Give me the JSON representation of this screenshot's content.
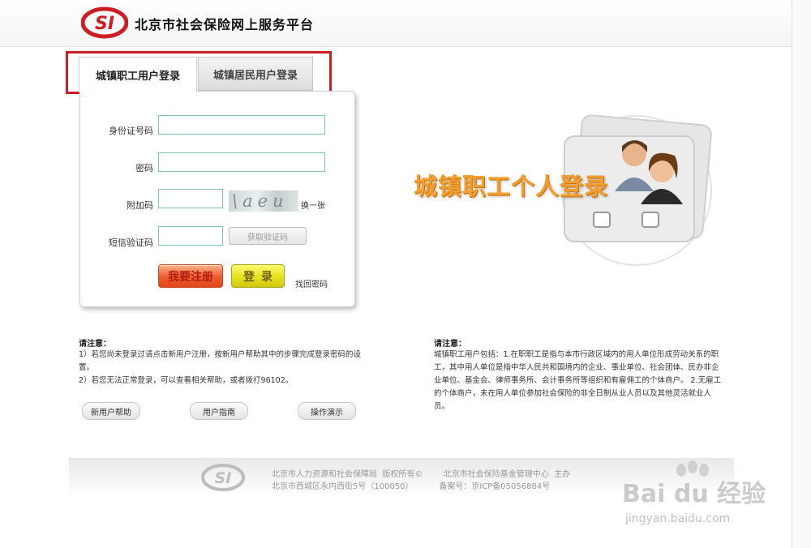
{
  "header": {
    "site_title": "北京市社会保险网上服务平台",
    "logo_text": "SI",
    "brand_color": "#cc1f25"
  },
  "tabs": [
    {
      "label": "城镇职工用户登录",
      "active": true
    },
    {
      "label": "城镇居民用户登录",
      "active": false
    }
  ],
  "login": {
    "id_label": "身份证号码",
    "id_value": "",
    "password_label": "密码",
    "password_value": "",
    "captcha_label": "附加码",
    "captcha_value": "",
    "captcha_image_text": "\\aeu",
    "refresh_label": "换一张",
    "sms_label": "短信验证码",
    "sms_value": "",
    "sms_button": "获取验证码",
    "register_button": "我要注册",
    "login_button": "登录",
    "forgot_link": "找回密码"
  },
  "banner": {
    "text": "城镇职工个人登录"
  },
  "notice_left": {
    "title": "请注意：",
    "line1": "1）若您尚未登录过请点击新用户注册，按新用户帮助其中的步骤完成登录密码的设",
    "line2": "置。",
    "line3": "2）若您无法正常登录，可以查看相关帮助，或者拨打96102。",
    "buttons": [
      "新用户帮助",
      "用户指南",
      "操作演示"
    ]
  },
  "notice_right": {
    "title": "请注意：",
    "lines": [
      "城镇职工用户包括：1.在职职工是指与本市行政区域内的用人单位形成劳动关系的职",
      "工，其中用人单位是指中华人民共和国境内的企业、事业单位、社会团体、民办非企",
      "业单位、基金会、律师事务所、会计事务所等组织和有雇佣工的个体商户。 2.无雇工",
      "的个体商户，未在用人单位参加社会保险的非全日制从业人员以及其他灵活就业人",
      "员。"
    ]
  },
  "footer": {
    "line1": "北京市人力资源和社会保障局  版权所有©        北京市社会保险基金管理中心  主办",
    "line2": "北京市西城区永内西街5号（100050）          备案号：京ICP备05056884号"
  },
  "watermark": {
    "text": "Bai du 经验",
    "sub": "jingyan.baidu.com"
  }
}
